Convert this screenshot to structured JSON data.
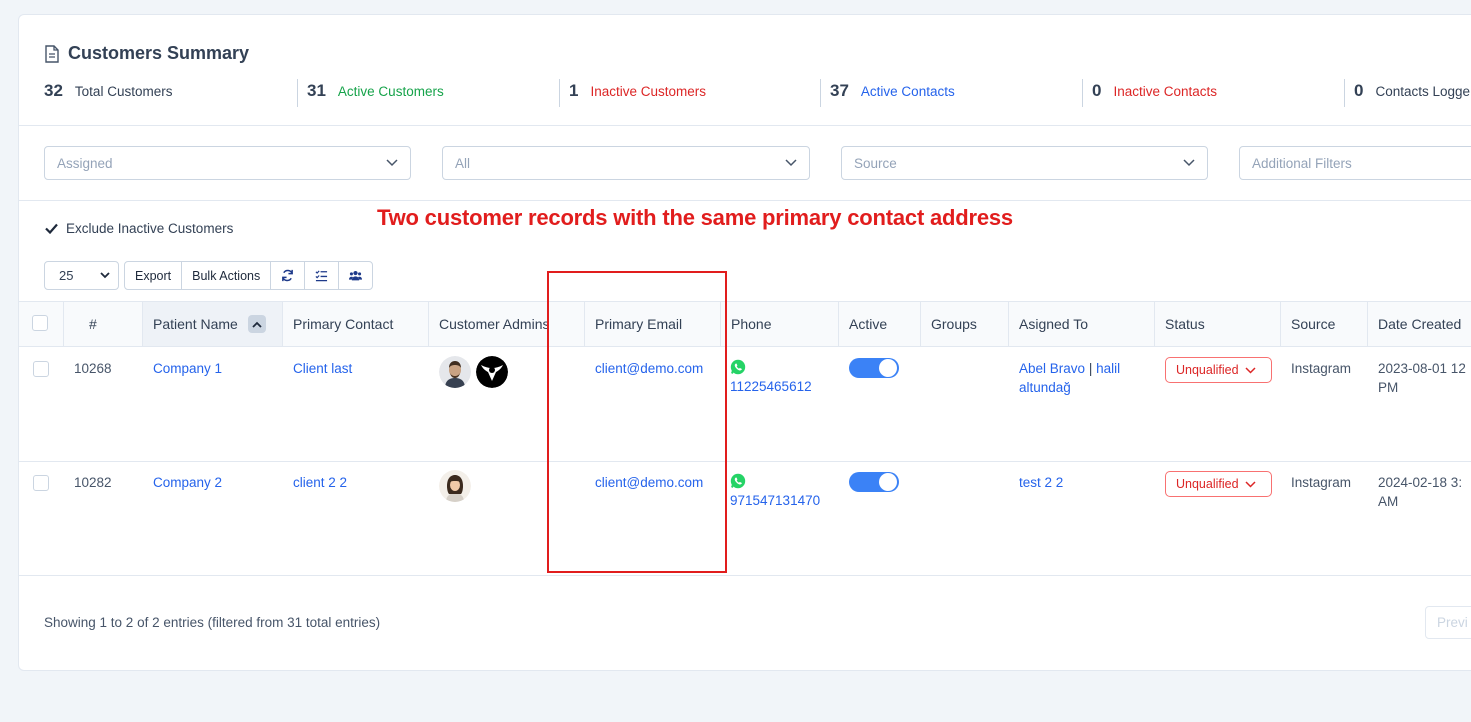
{
  "summary": {
    "title": "Customers Summary",
    "stats": [
      {
        "num": "32",
        "label": "Total Customers",
        "color": "#334155"
      },
      {
        "num": "31",
        "label": "Active Customers",
        "color": "#16a34a"
      },
      {
        "num": "1",
        "label": "Inactive Customers",
        "color": "#dc2626"
      },
      {
        "num": "37",
        "label": "Active Contacts",
        "color": "#2563eb"
      },
      {
        "num": "0",
        "label": "Inactive Contacts",
        "color": "#dc2626"
      },
      {
        "num": "0",
        "label": "Contacts Logge",
        "color": "#334155"
      }
    ]
  },
  "filters": {
    "assigned": "Assigned",
    "all": "All",
    "source": "Source",
    "additional": "Additional Filters"
  },
  "annotation": "Two customer records with the same primary contact address",
  "exclude_inactive": {
    "label": "Exclude Inactive Customers",
    "checked": true
  },
  "toolbar": {
    "page_size": "25",
    "export": "Export",
    "bulk_actions": "Bulk Actions"
  },
  "table": {
    "headers": [
      "#",
      "Patient Name",
      "Primary Contact",
      "Customer Admins",
      "Primary Email",
      "Phone",
      "Active",
      "Groups",
      "Asigned To",
      "Status",
      "Source",
      "Date Created"
    ],
    "rows": [
      {
        "id": "10268",
        "name": "Company 1",
        "contact": "Client last",
        "email": "client@demo.com",
        "phone": "11225465612",
        "active": true,
        "groups": "",
        "assigned_a": "Abel Bravo",
        "assigned_sep": "|",
        "assigned_b": "halil",
        "assigned_c": "altundağ",
        "status": "Unqualified",
        "source": "Instagram",
        "date_1": "2023-08-01 12",
        "date_2": "PM"
      },
      {
        "id": "10282",
        "name": "Company 2",
        "contact": "client 2 2",
        "email": "client@demo.com",
        "phone": "971547131470",
        "active": true,
        "groups": "",
        "assigned_a": "test 2 2",
        "status": "Unqualified",
        "source": "Instagram",
        "date_1": "2024-02-18 3:",
        "date_2": "AM"
      }
    ]
  },
  "footer": {
    "info": "Showing 1 to 2 of 2 entries (filtered from 31 total entries)",
    "prev": "Previ"
  },
  "colors": {
    "accent": "#2563eb",
    "danger": "#dc2626",
    "success": "#16a34a",
    "annotation": "#e11d1d",
    "whatsapp": "#25d366"
  }
}
